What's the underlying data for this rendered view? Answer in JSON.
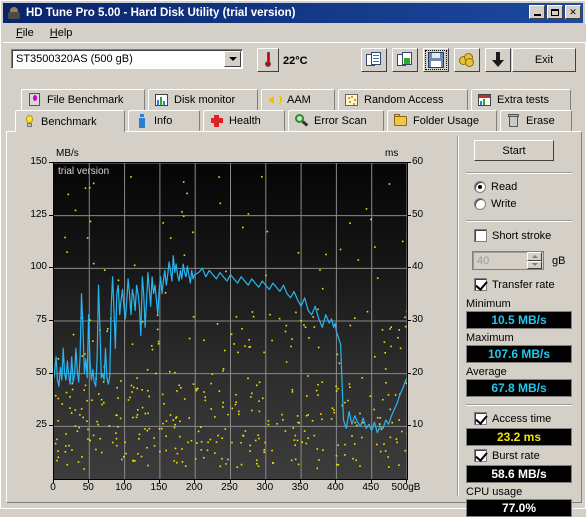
{
  "window": {
    "title": "HD Tune Pro 5.00 - Hard Disk Utility (trial version)",
    "icon": "hdtune-app-icon",
    "minimize": "_",
    "maximize": "□",
    "close": "✕"
  },
  "menu": {
    "items": [
      {
        "label": "File"
      },
      {
        "label": "Help"
      }
    ]
  },
  "toolbar": {
    "drive_selected": "ST3500320AS (500 gB)",
    "temperature": "22°C",
    "temperature_icon": "thermometer-icon",
    "buttons": [
      {
        "name": "copy-text-button",
        "icon": "copy-documents-icon"
      },
      {
        "name": "copy-image-button",
        "icon": "copy-image-icon"
      },
      {
        "name": "save-button",
        "icon": "floppy-save-icon",
        "focused": true
      },
      {
        "name": "options-button",
        "icon": "gold-coins-icon"
      },
      {
        "name": "download-button",
        "icon": "down-arrow-icon"
      }
    ],
    "exit_label": "Exit"
  },
  "tabs_top": [
    {
      "label": "File Benchmark",
      "icon": "file-benchmark-icon"
    },
    {
      "label": "Disk monitor",
      "icon": "bar-chart-icon"
    },
    {
      "label": "AAM",
      "icon": "speaker-icon"
    },
    {
      "label": "Random Access",
      "icon": "scatter-dots-icon"
    },
    {
      "label": "Extra tests",
      "icon": "extra-tests-icon"
    }
  ],
  "tabs_bottom": [
    {
      "label": "Benchmark",
      "icon": "lightbulb-icon",
      "active": true
    },
    {
      "label": "Info",
      "icon": "info-icon",
      "active": false
    },
    {
      "label": "Health",
      "icon": "red-cross-icon",
      "active": false
    },
    {
      "label": "Error Scan",
      "icon": "magnifier-icon",
      "active": false
    },
    {
      "label": "Folder Usage",
      "icon": "folder-icon",
      "active": false
    },
    {
      "label": "Erase",
      "icon": "trash-icon",
      "active": false
    }
  ],
  "panel": {
    "start_label": "Start",
    "read_label": "Read",
    "write_label": "Write",
    "read_selected": true,
    "short_stroke_label": "Short stroke",
    "short_stroke_checked": false,
    "short_stroke_value": "40",
    "short_stroke_unit": "gB",
    "transfer_rate_label": "Transfer rate",
    "transfer_rate_checked": true,
    "minimum_label": "Minimum",
    "minimum_value": "10.5 MB/s",
    "maximum_label": "Maximum",
    "maximum_value": "107.6 MB/s",
    "average_label": "Average",
    "average_value": "67.8 MB/s",
    "access_time_label": "Access time",
    "access_time_checked": true,
    "access_time_value": "23.2 ms",
    "burst_rate_label": "Burst rate",
    "burst_rate_checked": true,
    "burst_rate_value": "58.6 MB/s",
    "cpu_usage_label": "CPU usage",
    "cpu_usage_value": "77.0%"
  },
  "colors": {
    "transfer_curve": "#29b6f0",
    "access_dots": "#f2e300",
    "value_cyan": "#23c6ef",
    "value_yellow": "#f2e300",
    "value_white": "#ffffff",
    "titlebar": "#0a246a",
    "face": "#d4d0c8"
  },
  "chart_data": {
    "type": "line",
    "title": "",
    "watermark": "trial version",
    "xlabel": "",
    "ylabel": "MB/s",
    "y2label": "ms",
    "xlim": [
      0,
      500
    ],
    "ylim": [
      0,
      150
    ],
    "y2lim": [
      0,
      60
    ],
    "xticks": [
      0,
      50,
      100,
      150,
      200,
      250,
      300,
      350,
      400,
      450,
      500
    ],
    "xticklabels": [
      "0",
      "50",
      "100",
      "150",
      "200",
      "250",
      "300",
      "350",
      "400",
      "450",
      "500gB"
    ],
    "yticks": [
      25,
      50,
      75,
      100,
      125,
      150
    ],
    "yticklabels": [
      "25",
      "50",
      "75",
      "100",
      "125",
      "150"
    ],
    "y2ticks": [
      10,
      20,
      30,
      40,
      50,
      60
    ],
    "y2ticklabels": [
      "10",
      "20",
      "30",
      "40",
      "50",
      "60"
    ],
    "grid": true,
    "legend": null,
    "series": [
      {
        "name": "Transfer rate",
        "type": "line",
        "color": "#29b6f0",
        "axis": "left",
        "unit": "MB/s",
        "x": [
          0,
          3,
          5,
          7,
          9,
          11,
          13,
          15,
          17,
          19,
          21,
          23,
          25,
          27,
          29,
          31,
          33,
          35,
          37,
          39,
          41,
          43,
          45,
          47,
          49,
          51,
          53,
          55,
          57,
          59,
          61,
          63,
          65,
          67,
          69,
          71,
          73,
          75,
          77,
          79,
          81,
          83,
          85,
          87,
          89,
          91,
          93,
          95,
          97,
          99,
          101,
          103,
          105,
          107,
          109,
          111,
          113,
          115,
          117,
          119,
          121,
          123,
          125,
          127,
          129,
          131,
          133,
          135,
          137,
          139,
          141,
          143,
          145,
          147,
          149,
          151,
          153,
          155,
          157,
          159,
          161,
          163,
          165,
          167,
          169,
          171,
          173,
          175,
          177,
          179,
          181,
          183,
          185,
          187,
          189,
          191,
          193,
          195,
          197,
          199,
          205,
          210,
          215,
          220,
          225,
          230,
          235,
          240,
          245,
          250,
          255,
          260,
          265,
          270,
          275,
          280,
          285,
          290,
          295,
          300,
          305,
          310,
          315,
          320,
          325,
          330,
          335,
          340,
          345,
          350,
          355,
          360,
          365,
          370,
          375,
          380,
          385,
          390,
          393,
          396,
          398,
          400,
          402,
          404,
          406,
          410,
          414,
          418,
          422,
          426,
          430,
          434,
          438,
          442,
          446,
          450,
          454,
          458,
          462,
          466,
          470,
          474,
          478,
          482,
          486,
          490,
          494,
          497,
          500
        ],
        "y": [
          48,
          58,
          47,
          44,
          53,
          47,
          62,
          50,
          47,
          56,
          49,
          45,
          58,
          46,
          49,
          62,
          51,
          46,
          58,
          88,
          72,
          50,
          57,
          48,
          78,
          56,
          47,
          52,
          46,
          44,
          57,
          92,
          72,
          48,
          50,
          47,
          62,
          48,
          45,
          49,
          82,
          96,
          80,
          62,
          88,
          92,
          78,
          85,
          90,
          82,
          76,
          84,
          95,
          88,
          78,
          90,
          86,
          80,
          92,
          88,
          82,
          68,
          96,
          88,
          72,
          84,
          98,
          90,
          82,
          96,
          88,
          92,
          85,
          78,
          90,
          96,
          88,
          94,
          99,
          92,
          97,
          103,
          99,
          94,
          106,
          98,
          102,
          97,
          94,
          99,
          95,
          102,
          98,
          96,
          101,
          97,
          93,
          99,
          95,
          97,
          98,
          100,
          96,
          99,
          97,
          95,
          98,
          96,
          94,
          97,
          95,
          93,
          96,
          94,
          92,
          95,
          93,
          91,
          94,
          92,
          90,
          93,
          91,
          89,
          92,
          88,
          86,
          89,
          85,
          82,
          86,
          80,
          78,
          82,
          76,
          72,
          78,
          74,
          76,
          72,
          74,
          70,
          68,
          66,
          64,
          28,
          24,
          32,
          26,
          30,
          27,
          25,
          29,
          24,
          26,
          23,
          27,
          22,
          25,
          24,
          28,
          26,
          30,
          33,
          36,
          40,
          43,
          46,
          48
        ]
      },
      {
        "name": "Access time",
        "type": "scatter",
        "color": "#f2e300",
        "axis": "right",
        "unit": "ms",
        "average": 23.2,
        "n_points": 420,
        "range_ms": [
          2,
          58
        ]
      }
    ],
    "summary": {
      "minimum_mbs": 10.5,
      "maximum_mbs": 107.6,
      "average_mbs": 67.8,
      "access_time_ms": 23.2,
      "burst_rate_mbs": 58.6,
      "cpu_usage_percent": 77.0
    }
  }
}
